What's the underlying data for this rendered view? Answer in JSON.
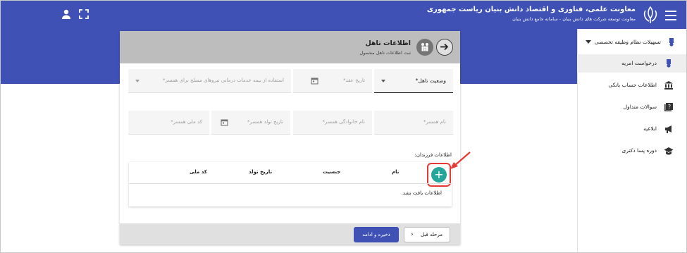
{
  "header": {
    "title": "معاونت علمی، فناوری و اقتصاد دانش بنیان ریاست جمهوری",
    "subtitle": "معاونت توسعه شرکت های دانش بنیان - سامانه جامع دانش بنیان",
    "icons": [
      "menu-icon",
      "emblem-icon",
      "fullscreen-icon",
      "user-icon"
    ],
    "color": "#3f51b5"
  },
  "sidebar": {
    "items": [
      {
        "label": "تسهیلات نظام وظیفه تخصصی",
        "icon": "badge-icon"
      },
      {
        "label": "درخواست امریه",
        "icon": "badge-icon"
      },
      {
        "label": "اطلاعات حساب بانکی",
        "icon": "bank-icon"
      },
      {
        "label": "سوالات متداول",
        "icon": "help-icon"
      },
      {
        "label": "ابلاغیه",
        "icon": "megaphone-icon"
      },
      {
        "label": "دوره پسا دکتری",
        "icon": "graduation-cap-icon"
      }
    ]
  },
  "form": {
    "title": "اطلاعات تاهل",
    "subtitle": "ثبت اطلاعات تاهل مشمول",
    "fields": {
      "marital_status": "وضعیت تاهل*",
      "marriage_date": "تاریخ عقد*",
      "spouse_insurance": "استفاده از بیمه خدمات درمانی نیروهای مسلح برای همسر*",
      "spouse_name": "نام همسر*",
      "spouse_family": "نام خانوادگی همسر*",
      "spouse_birth": "تاریخ تولد همسر*",
      "spouse_nid": "کد ملی همسر*"
    },
    "children_label": "اطلاعات فرزندان:",
    "table": {
      "columns": [
        "نام",
        "جنسیت",
        "تاریخ تولد",
        "کد ملی"
      ],
      "empty_message": "اطلاعات یافت نشد.",
      "add_icon": "+"
    },
    "buttons": {
      "prev": "مرحله قبل",
      "save": "ذخیره و ادامه"
    },
    "accent": "#26a69a",
    "highlight": "#e53935"
  }
}
